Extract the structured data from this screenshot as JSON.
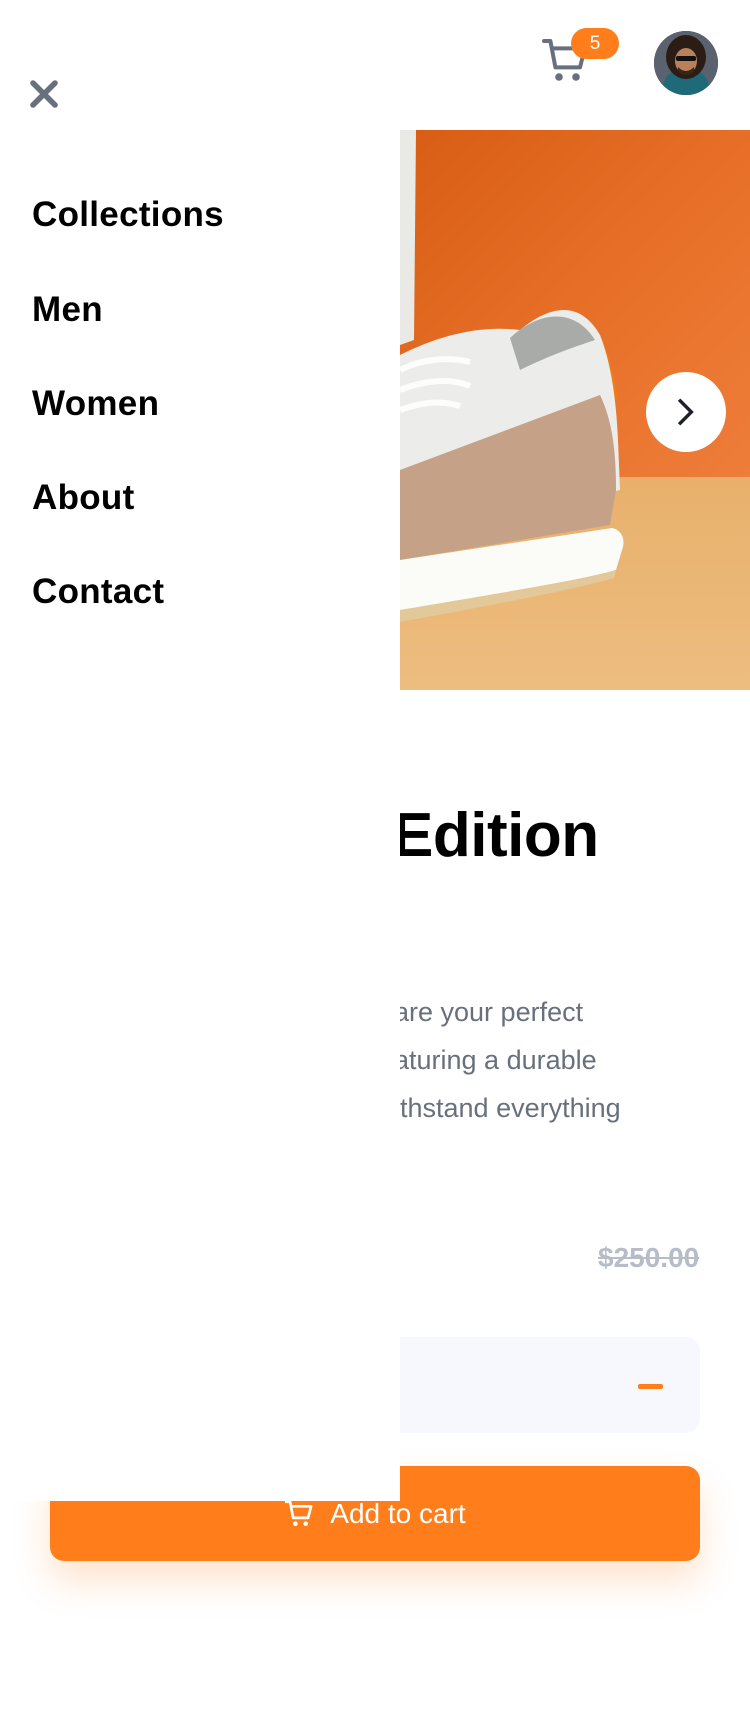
{
  "header": {
    "cart_count": "5",
    "cart_icon": "cart-icon",
    "avatar_icon": "avatar"
  },
  "menu": {
    "close_icon": "close-icon",
    "items": [
      {
        "label": "Collections"
      },
      {
        "label": "Men"
      },
      {
        "label": "Women"
      },
      {
        "label": "About"
      },
      {
        "label": "Contact"
      }
    ]
  },
  "product": {
    "title": "Edition",
    "description_lines": [
      "are your perfect",
      "aturing a durable",
      "ithstand everything"
    ],
    "old_price": "$250.00",
    "add_to_cart_label": "Add to cart"
  },
  "colors": {
    "accent": "#ff7e1b",
    "text_dark": "#000000",
    "text_muted": "#68707d",
    "price_muted": "#b6bcc8",
    "qty_bg": "#f6f8fd"
  }
}
